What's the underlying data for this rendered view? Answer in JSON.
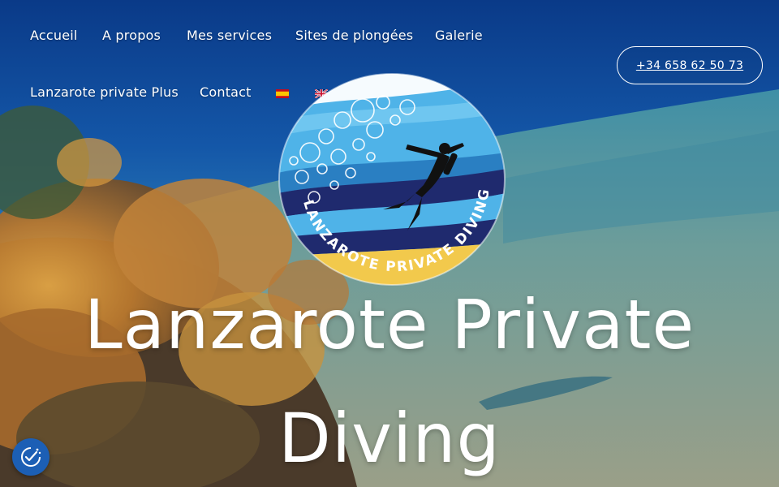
{
  "nav": {
    "items": [
      {
        "label": "Accueil"
      },
      {
        "label": "A propos"
      },
      {
        "label": "Mes services"
      },
      {
        "label": "Sites de plongées"
      },
      {
        "label": "Galerie"
      },
      {
        "label": "Lanzarote private Plus"
      },
      {
        "label": "Contact"
      }
    ],
    "languages": [
      {
        "icon": "spain-flag-icon"
      },
      {
        "icon": "uk-flag-icon"
      }
    ]
  },
  "phone": {
    "label": "+34 658 62 50 73"
  },
  "logo": {
    "text": "LANZAROTE PRIVATE DIVING",
    "icon": "scuba-diver-icon"
  },
  "hero": {
    "line1": "Lanzarote Private",
    "line2": "Diving"
  },
  "cookie": {
    "icon": "cookie-consent-icon"
  },
  "colors": {
    "water_deep": "#0b3f8c",
    "water_light": "#3aa0d8",
    "sand": "#8a9a8c",
    "coral": "#c98a3a",
    "logo_yellow": "#f2c94c",
    "logo_navy": "#1f2a6e",
    "cookie_blue": "#1c5fb5"
  }
}
